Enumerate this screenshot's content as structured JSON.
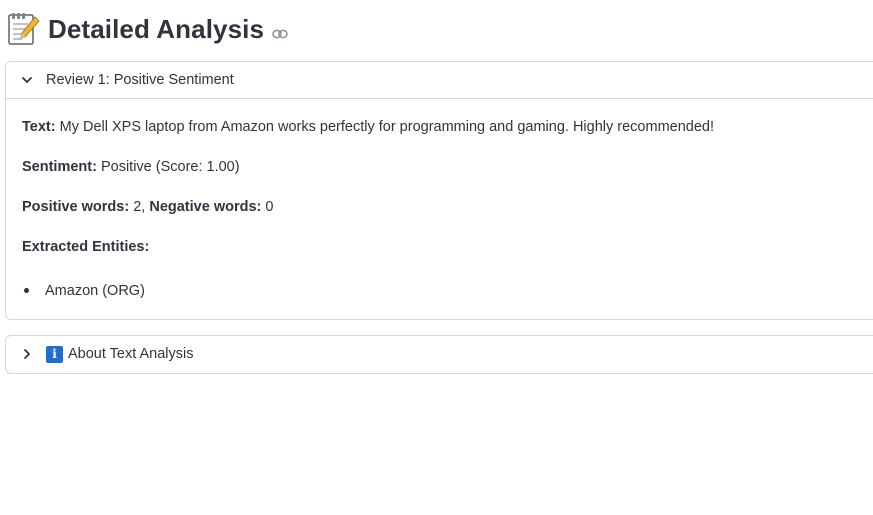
{
  "heading": {
    "title": "Detailed Analysis",
    "icon": "memo-icon",
    "link_icon": "link-icon"
  },
  "review_expander": {
    "label": "Review 1: Positive Sentiment",
    "expanded": true,
    "text_label": "Text:",
    "text_value": "My Dell XPS laptop from Amazon works perfectly for programming and gaming. Highly recommended!",
    "sentiment_label": "Sentiment:",
    "sentiment_value": "Positive (Score: 1.00)",
    "positive_words_label": "Positive words:",
    "positive_words_value": "2",
    "separator": ",",
    "negative_words_label": "Negative words:",
    "negative_words_value": "0",
    "entities_label": "Extracted Entities:",
    "entities": [
      "Amazon (ORG)"
    ]
  },
  "about_expander": {
    "label": "About Text Analysis",
    "icon_glyph": "i",
    "expanded": false
  },
  "colors": {
    "text": "#31333f",
    "border": "#d5d8de",
    "info_blue": "#1f6fd1"
  }
}
